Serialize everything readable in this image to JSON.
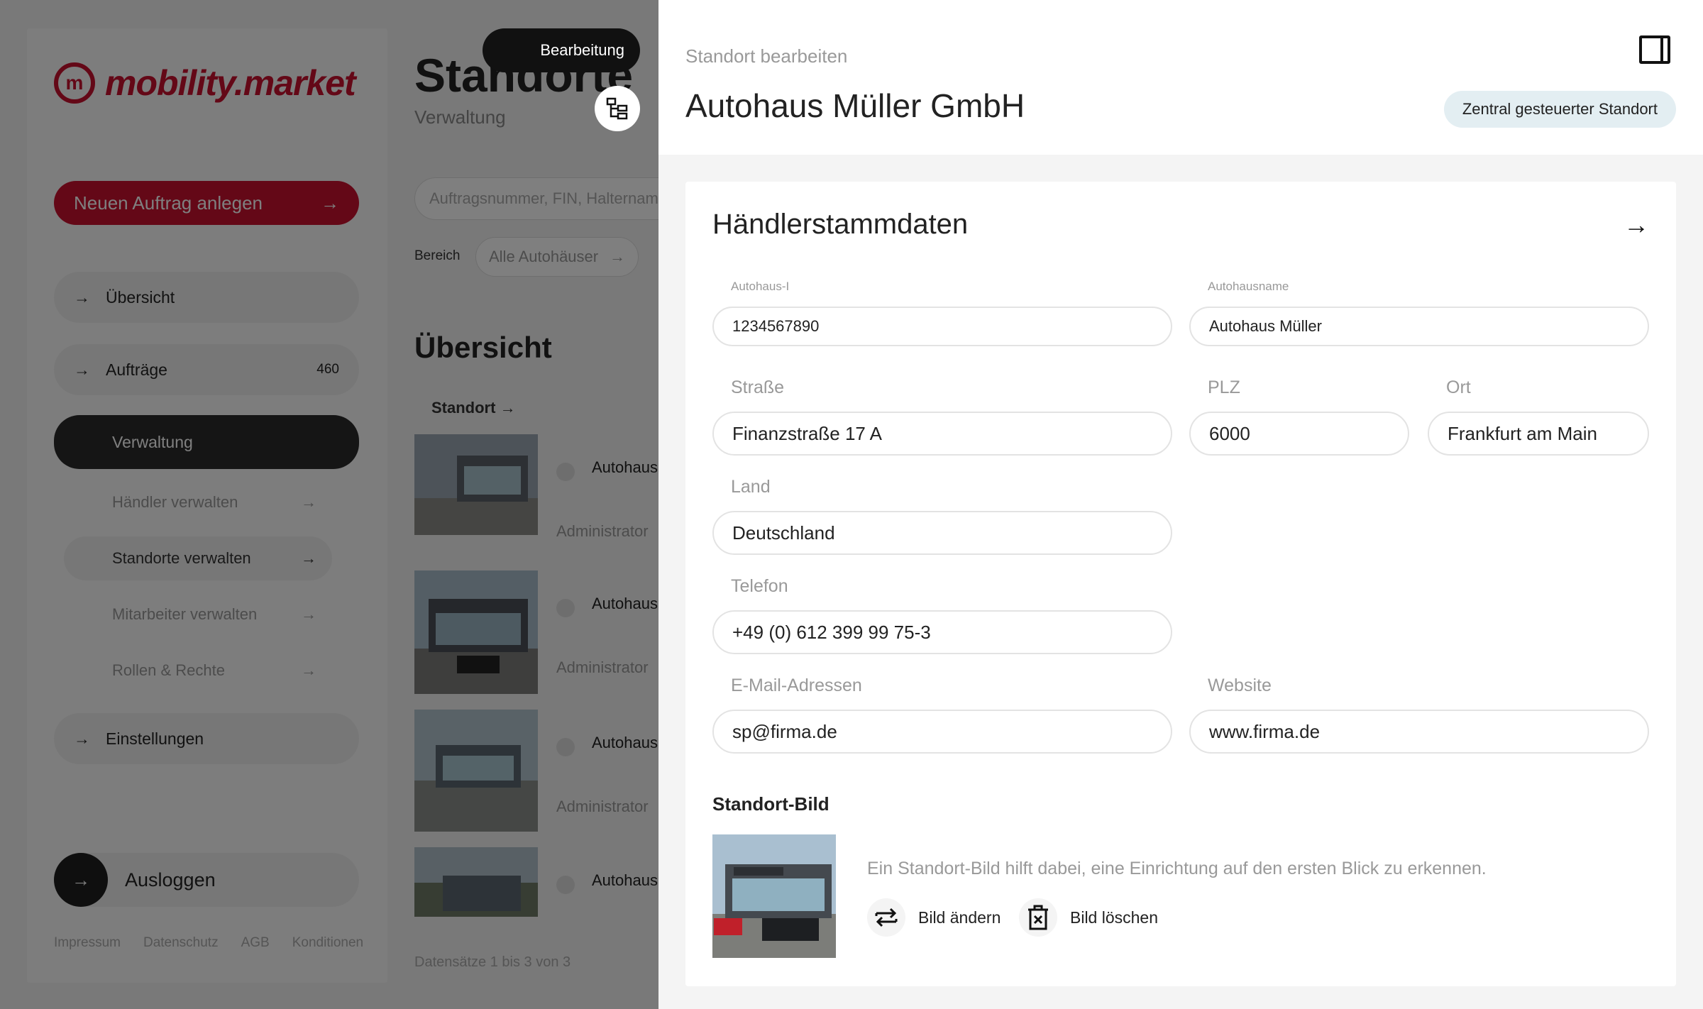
{
  "sidebar": {
    "brand": "mobility.market",
    "new_order_label": "Neuen Auftrag anlegen",
    "items": [
      {
        "label": "Übersicht"
      },
      {
        "label": "Aufträge",
        "count": "460"
      },
      {
        "label": "Verwaltung"
      },
      {
        "label": "Einstellungen"
      }
    ],
    "sub_items": [
      {
        "label": "Händler verwalten"
      },
      {
        "label": "Standorte verwalten"
      },
      {
        "label": "Mitarbeiter verwalten"
      },
      {
        "label": "Rollen & Rechte"
      }
    ],
    "logout_label": "Ausloggen",
    "footer": [
      "Impressum",
      "Datenschutz",
      "AGB",
      "Konditionen"
    ]
  },
  "main": {
    "title": "Standorte",
    "subtitle": "Verwaltung",
    "toggle_label": "Bearbeitung",
    "search_placeholder": "Auftragsnummer, FIN, Haltername",
    "filter_label": "Bereich",
    "filter_value": "Alle Autohäuser",
    "section_title": "Übersicht",
    "column_header": "Standort",
    "rows": [
      {
        "name": "Autohaus",
        "role": "Administrator"
      },
      {
        "name": "Autohaus",
        "role": "Administrator"
      },
      {
        "name": "Autohaus",
        "role": "Administrator"
      },
      {
        "name": "Autohaus",
        "role": ""
      }
    ],
    "records": "Datensätze 1 bis 3 von 3"
  },
  "panel": {
    "caption": "Standort bearbeiten",
    "title": "Autohaus Müller GmbH",
    "badge": "Zentral gesteuerter Standort",
    "card_title": "Händlerstammdaten",
    "fields": {
      "autohaus_id": {
        "label": "Autohaus-I",
        "value": "1234567890"
      },
      "autohausname": {
        "label": "Autohausname",
        "value": "Autohaus Müller"
      },
      "strasse": {
        "label": "Straße",
        "value": "Finanzstraße 17 A"
      },
      "plz": {
        "label": "PLZ",
        "value": "6000"
      },
      "ort": {
        "label": "Ort",
        "value": "Frankfurt am Main"
      },
      "land": {
        "label": "Land",
        "value": "Deutschland"
      },
      "telefon": {
        "label": "Telefon",
        "value": "+49 (0) 612 399 99 75-3"
      },
      "email": {
        "label": "E-Mail-Adressen",
        "value": "sp@firma.de"
      },
      "website": {
        "label": "Website",
        "value": "www.firma.de"
      }
    },
    "image_section": {
      "title": "Standort-Bild",
      "hint": "Ein Standort-Bild hilft dabei, eine Einrichtung auf den ersten Blick zu erkennen.",
      "change_label": "Bild ändern",
      "delete_label": "Bild löschen"
    }
  },
  "colors": {
    "brand": "#c8102e",
    "badge_bg": "#e3eef2",
    "dark": "#2b2b2b"
  }
}
